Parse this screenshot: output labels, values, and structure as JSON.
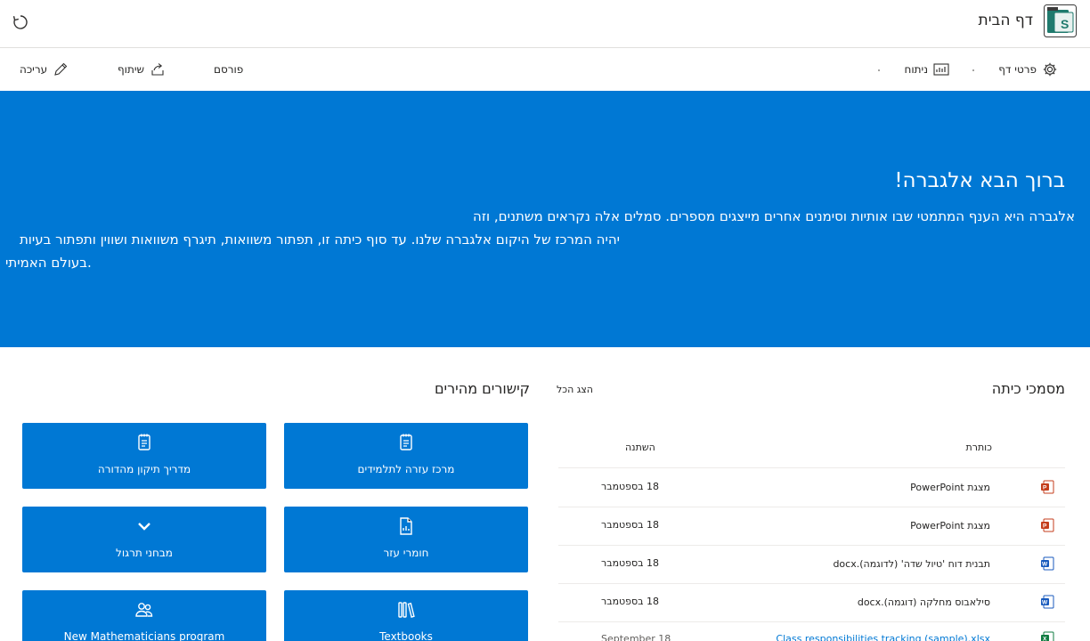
{
  "header": {
    "site_title": "דף הבית"
  },
  "command_bar": {
    "page_details": "פרטי דף",
    "analytics": "ניתוח",
    "published": "פורסם",
    "share": "שיתוף",
    "edit": "עריכה"
  },
  "hero": {
    "title": "ברוך הבא אלגברה!",
    "lines": [
      "אלגברה היא הענף המתמטי שבו אותיות וסימנים אחרים מייצגים מספרים. סמלים אלה נקראים משתנים, וזה",
      "יהיה המרכז של היקום אלגברה שלנו. עד סוף כיתה זו, תפתור משוואות, תיגרף משוואות ושווין ותפתור בעיות",
      "בעולם האמיתי."
    ]
  },
  "documents": {
    "title": "מסמכי כיתה",
    "see_all": "הצג הכל",
    "col_title": "כותרת",
    "col_modified": "השתנה",
    "rows": [
      {
        "type": "ppt",
        "name": "מצגת PowerPoint",
        "date": "18 בספטמבר"
      },
      {
        "type": "ppt",
        "name": "מצגת PowerPoint",
        "date": "18 בספטמבר"
      },
      {
        "type": "word",
        "name": "תבנית דוח 'טיול שדה' (לדוגמה).docx",
        "date": "18 בספטמבר"
      },
      {
        "type": "word",
        "name": "סילאבוס מחלקה (דוגמה).docx",
        "date": "18 בספטמבר"
      },
      {
        "type": "excel",
        "name": "Class responsibilities tracking (sample).xlsx",
        "date": "September 18"
      }
    ]
  },
  "quick_links": {
    "title": "קישורים מהירים",
    "items": [
      {
        "label": "מרכז עזרה לתלמידים",
        "icon": "notes-icon"
      },
      {
        "label": "מדריך תיקון מהדורה",
        "icon": "notes-icon"
      },
      {
        "label": "חומרי עזר",
        "icon": "document-chart-icon"
      },
      {
        "label": "מבחני תרגול",
        "icon": "chevron-down-icon"
      },
      {
        "label": "Textbooks",
        "icon": "books-icon"
      },
      {
        "label": "New Mathematicians program",
        "icon": "people-icon"
      }
    ]
  },
  "colors": {
    "brand": "#0078d4",
    "text": "#252423",
    "border": "#e1dfdd"
  }
}
